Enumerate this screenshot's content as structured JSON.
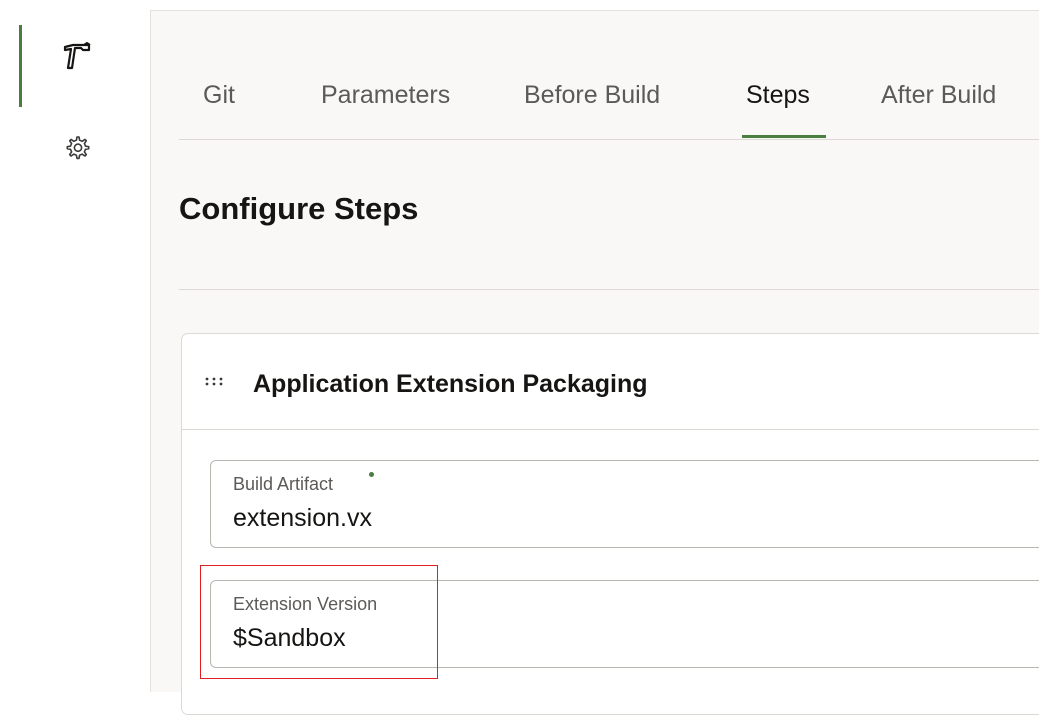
{
  "rail": {
    "items": [
      {
        "icon": "hammer-icon",
        "active": true
      },
      {
        "icon": "gear-icon",
        "active": false
      }
    ],
    "accent": "#4a7d3f"
  },
  "tabs": [
    {
      "label": "Git",
      "active": false
    },
    {
      "label": "Parameters",
      "active": false
    },
    {
      "label": "Before Build",
      "active": false
    },
    {
      "label": "Steps",
      "active": true
    },
    {
      "label": "After Build",
      "active": false
    }
  ],
  "page": {
    "title": "Configure Steps"
  },
  "step": {
    "title": "Application Extension Packaging",
    "fields": {
      "build_artifact": {
        "label": "Build Artifact",
        "required": true,
        "value": "extension.vx"
      },
      "extension_version": {
        "label": "Extension Version",
        "required": false,
        "value": "$Sandbox"
      }
    }
  },
  "annotation": {
    "highlight_color": "#e02020",
    "target": "extension_version"
  }
}
